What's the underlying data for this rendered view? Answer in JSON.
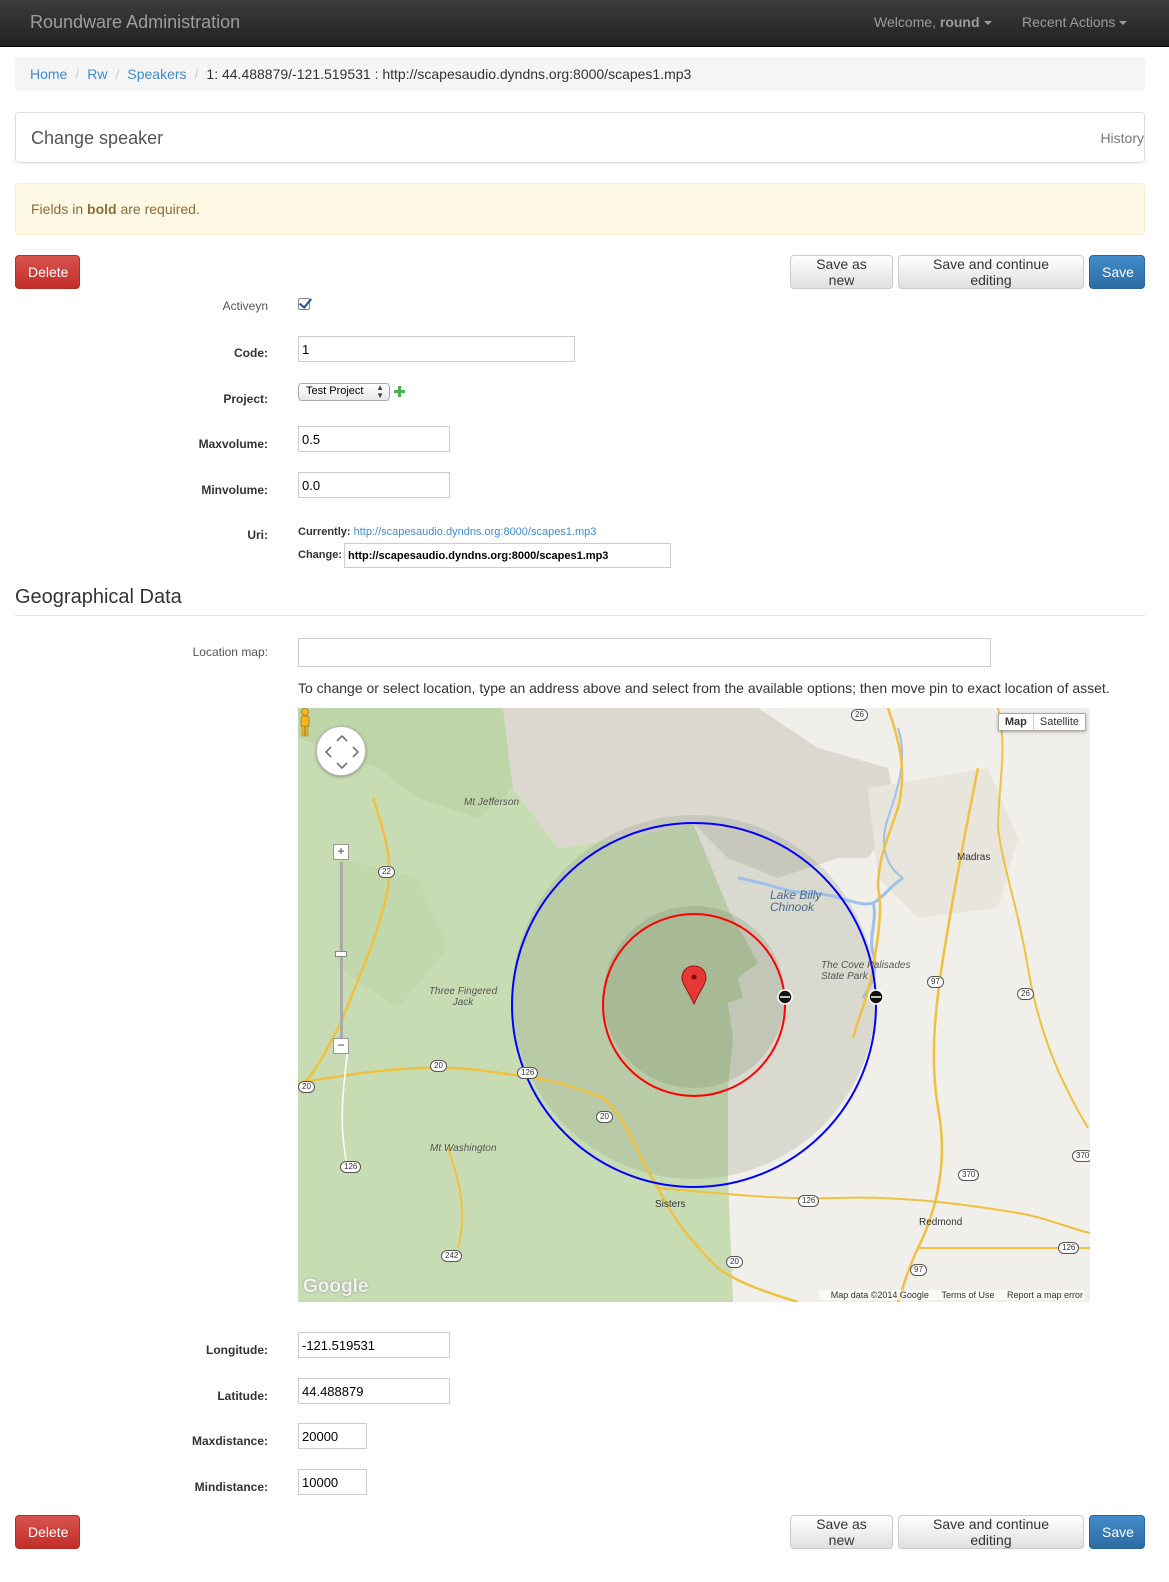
{
  "navbar": {
    "brand": "Roundware Administration",
    "welcome_prefix": "Welcome, ",
    "username": "round",
    "recent_actions": "Recent Actions"
  },
  "breadcrumb": {
    "items": [
      "Home",
      "Rw",
      "Speakers"
    ],
    "current": "1: 44.488879/-121.519531 : http://scapesaudio.dyndns.org:8000/scapes1.mp3",
    "separator": "/"
  },
  "page": {
    "title": "Change speaker",
    "history_label": "History"
  },
  "alert": {
    "prefix": "Fields in ",
    "bold": "bold",
    "suffix": " are required."
  },
  "actions": {
    "delete": "Delete",
    "save_as_new": "Save as new",
    "save_continue": "Save and continue editing",
    "save": "Save"
  },
  "form": {
    "activeyn_label": "Activeyn",
    "activeyn_checked": true,
    "code_label": "Code:",
    "code_value": "1",
    "project_label": "Project:",
    "project_value": "Test Project",
    "maxvolume_label": "Maxvolume:",
    "maxvolume_value": "0.5",
    "minvolume_label": "Minvolume:",
    "minvolume_value": "0.0",
    "uri_label": "Uri:",
    "uri_currently_label": "Currently:",
    "uri_currently_value": "http://scapesaudio.dyndns.org:8000/scapes1.mp3",
    "uri_change_label": "Change:",
    "uri_change_value": "http://scapesaudio.dyndns.org:8000/scapes1.mp3"
  },
  "geo": {
    "section_title": "Geographical Data",
    "location_map_label": "Location map:",
    "location_map_value": "",
    "help_text": "To change or select location, type an address above and select from the available options; then move pin to exact location of asset.",
    "longitude_label": "Longitude:",
    "longitude_value": "-121.519531",
    "latitude_label": "Latitude:",
    "latitude_value": "44.488879",
    "maxdistance_label": "Maxdistance:",
    "maxdistance_value": "20000",
    "mindistance_label": "Mindistance:",
    "mindistance_value": "10000"
  },
  "map": {
    "type_map": "Map",
    "type_satellite": "Satellite",
    "places": [
      "Mt Jefferson",
      "Three Fingered Jack",
      "Mt Washington"
    ],
    "cities": [
      "Madras",
      "Sisters",
      "Redmond"
    ],
    "water": "Lake Billy Chinook",
    "park": "The Cove Palisades State Park",
    "routes": [
      "26",
      "22",
      "97",
      "26",
      "20",
      "126",
      "20",
      "20",
      "126",
      "370",
      "370",
      "126",
      "242",
      "20",
      "97",
      "126"
    ],
    "logo": "Google",
    "footer": [
      "Map data ©2014 Google",
      "Terms of Use",
      "Report a map error"
    ],
    "colors": {
      "forest": "#c8dcb4",
      "outer_circle": "#0000ff",
      "inner_circle": "#ff0000",
      "pin": "#e53935"
    }
  },
  "colors": {
    "danger": "#d9534f",
    "primary": "#428bca",
    "link": "#428bca",
    "alert_bg": "#fcf8e3"
  }
}
